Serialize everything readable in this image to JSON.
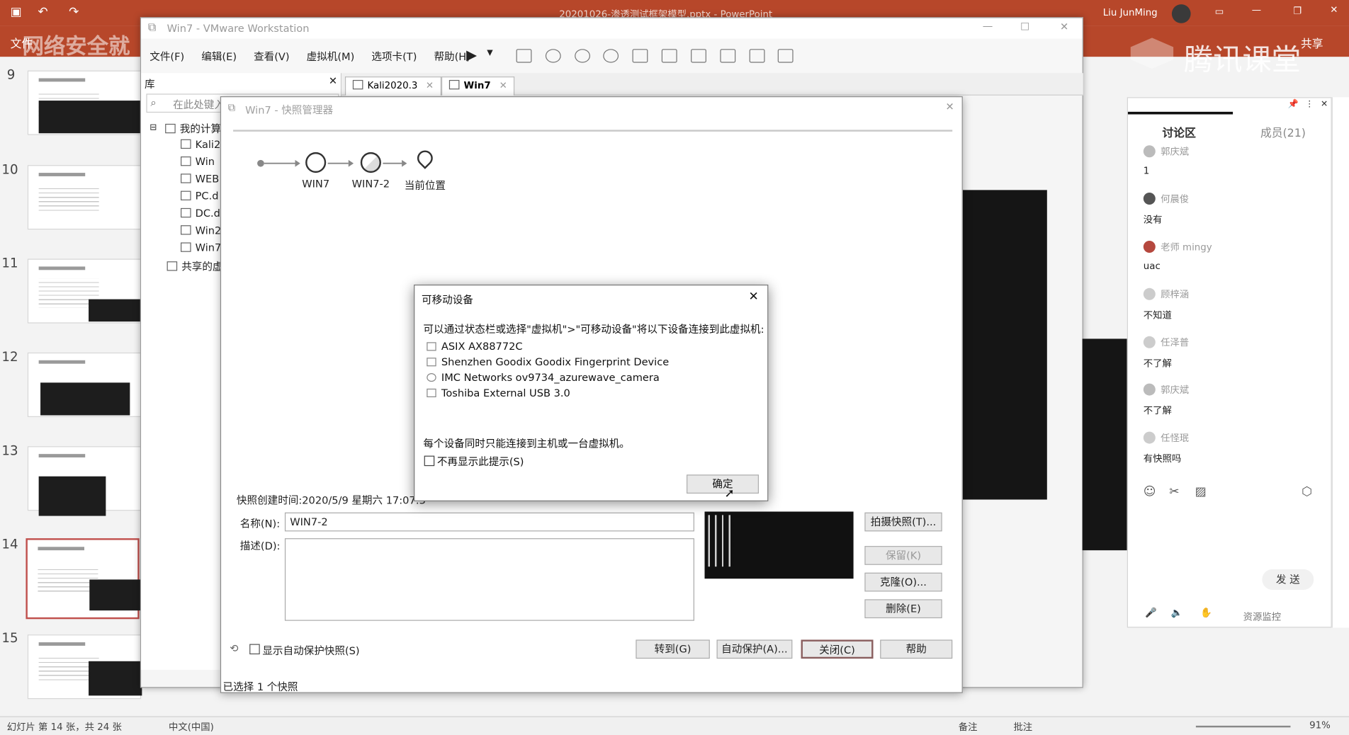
{
  "ppt": {
    "title": "20201026-渗透测试框架模型.pptx - PowerPoint",
    "user": "Liu JunMing",
    "share": "共享",
    "tab_file": "文件",
    "brand_text": "网络安全就",
    "slide_numbers": [
      "9",
      "10",
      "11",
      "12",
      "13",
      "14",
      "15"
    ],
    "status_slide": "幻灯片 第 14 张，共 24 张",
    "status_lang": "中文(中国)",
    "status_notes": "备注",
    "status_comments": "批注",
    "zoom": "91%"
  },
  "vmware": {
    "title": "Win7 - VMware Workstation",
    "menu": [
      "文件(F)",
      "编辑(E)",
      "查看(V)",
      "虚拟机(M)",
      "选项卡(T)",
      "帮助(H)"
    ],
    "library_title": "库",
    "search_placeholder": "在此处键入",
    "tree": [
      "我的计算",
      "Kali2",
      "Win",
      "WEB",
      "PC.d",
      "DC.d",
      "Win2",
      "Win7",
      "共享的虚"
    ],
    "tabs": [
      "Kali2020.3",
      "Win7"
    ]
  },
  "snapshot": {
    "title": "Win7 - 快照管理器",
    "nodes": [
      "WIN7",
      "WIN7-2",
      "当前位置"
    ],
    "created": "快照创建时间:2020/5/9 星期六 17:07:3",
    "name_label": "名称(N):",
    "name_value": "WIN7-2",
    "desc_label": "描述(D):",
    "buttons": {
      "take": "拍摄快照(T)...",
      "keep": "保留(K)",
      "clone": "克隆(O)...",
      "delete": "删除(E)",
      "goto": "转到(G)",
      "autoprotect": "自动保护(A)...",
      "close": "关闭(C)",
      "help": "帮助"
    },
    "show_auto": "显示自动保护快照(S)",
    "status": "已选择 1 个快照"
  },
  "removable": {
    "title": "可移动设备",
    "intro": "可以通过状态栏或选择\"虚拟机\">\"可移动设备\"将以下设备连接到此虚拟机:",
    "devices": [
      "ASIX AX88772C",
      "Shenzhen Goodix Goodix Fingerprint Device",
      "IMC Networks ov9734_azurewave_camera",
      "Toshiba External USB 3.0"
    ],
    "note": "每个设备同时只能连接到主机或一台虚拟机。",
    "dont_show": "不再显示此提示(S)",
    "ok": "确定"
  },
  "tencent": {
    "logo": "腾讯课堂",
    "tab_discussion": "讨论区",
    "tab_members": "成员(21)",
    "messages": [
      {
        "name": "郭庆斌",
        "text": "1"
      },
      {
        "name": "何晨俊",
        "text": "没有"
      },
      {
        "name": "老师 mingy",
        "text": "uac"
      },
      {
        "name": "顾梓涵",
        "text": "不知道"
      },
      {
        "name": "任泽普",
        "text": "不了解"
      },
      {
        "name": "郭庆斌",
        "text": "不了解"
      },
      {
        "name": "任怪珉",
        "text": "有快照吗"
      }
    ],
    "send": "发 送",
    "monitor": "资源监控"
  }
}
